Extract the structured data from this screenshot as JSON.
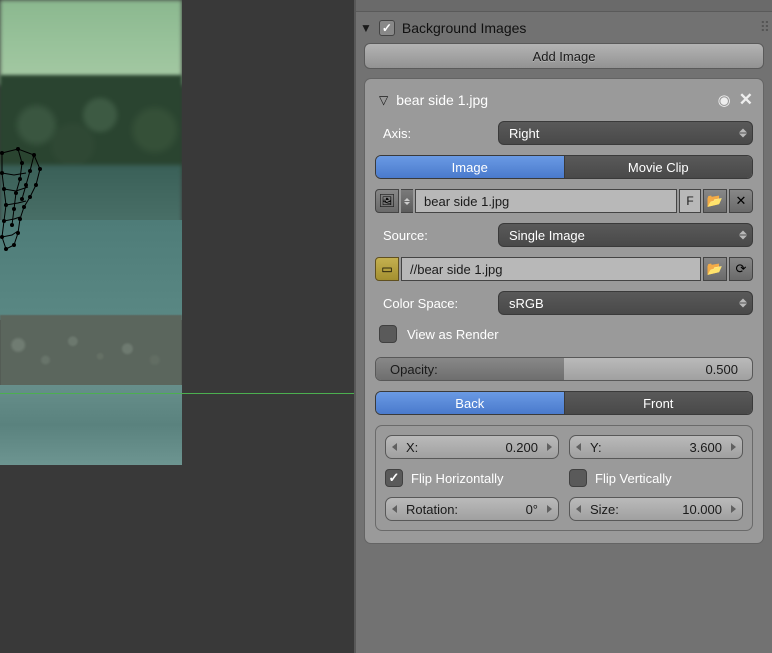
{
  "header": {
    "title": "Background Images"
  },
  "add_button": "Add Image",
  "image_entry": {
    "name": "bear side 1.jpg",
    "axis_label": "Axis:",
    "axis_value": "Right",
    "mode": {
      "image": "Image",
      "movie": "Movie Clip"
    },
    "datablock_name": "bear side 1.jpg",
    "fake_user": "F",
    "source_label": "Source:",
    "source_value": "Single Image",
    "filepath": "//bear side 1.jpg",
    "colorspace_label": "Color Space:",
    "colorspace_value": "sRGB",
    "view_as_render": "View as Render",
    "opacity_label": "Opacity:",
    "opacity_value": "0.500",
    "depth": {
      "back": "Back",
      "front": "Front"
    },
    "x_label": "X:",
    "x_value": "0.200",
    "y_label": "Y:",
    "y_value": "3.600",
    "flip_h": "Flip Horizontally",
    "flip_v": "Flip Vertically",
    "rotation_label": "Rotation:",
    "rotation_value": "0°",
    "size_label": "Size:",
    "size_value": "10.000"
  }
}
